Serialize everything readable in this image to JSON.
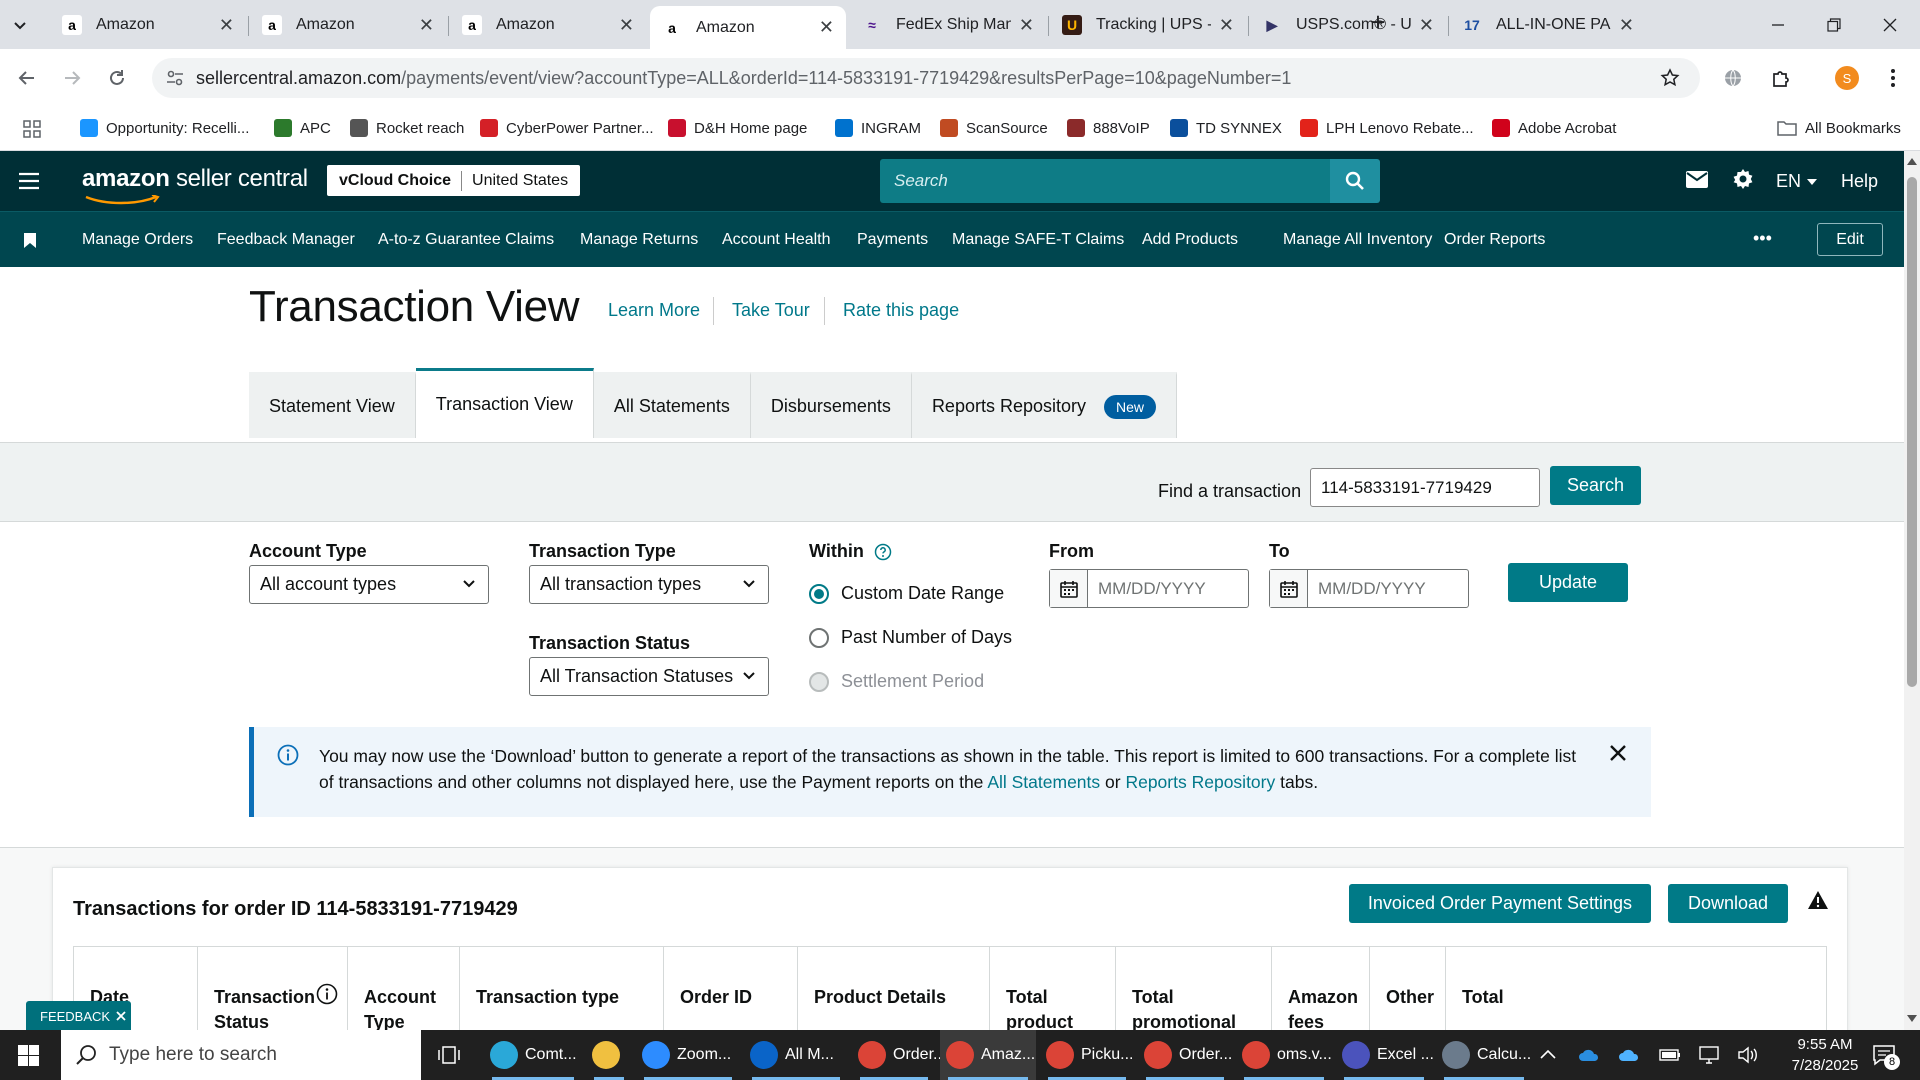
{
  "browser": {
    "tabs": [
      {
        "title": "Amazon",
        "icon": "amazon-icon"
      },
      {
        "title": "Amazon",
        "icon": "amazon-icon"
      },
      {
        "title": "Amazon",
        "icon": "amazon-icon"
      },
      {
        "title": "Amazon",
        "icon": "amazon-icon",
        "active": true
      },
      {
        "title": "FedEx Ship Mana",
        "icon": "fedex-icon"
      },
      {
        "title": "Tracking | UPS - U",
        "icon": "ups-icon"
      },
      {
        "title": "USPS.com® - US",
        "icon": "usps-icon"
      },
      {
        "title": "ALL-IN-ONE PAC",
        "icon": "seventeen-track-icon"
      }
    ],
    "url_host": "sellercentral.amazon.com",
    "url_path": "/payments/event/view?accountType=ALL&orderId=114-5833191-7719429&resultsPerPage=10&pageNumber=1",
    "profile_initial": "S",
    "bookmarks": [
      {
        "label": "Opportunity: Recelli...",
        "color": "#1b96ff"
      },
      {
        "label": "APC",
        "color": "#2c7a2c"
      },
      {
        "label": "Rocket reach",
        "color": "#555"
      },
      {
        "label": "CyberPower Partner...",
        "color": "#d42027"
      },
      {
        "label": "D&H Home page",
        "color": "#c8102e"
      },
      {
        "label": "INGRAM",
        "color": "#0072ce"
      },
      {
        "label": "ScanSource",
        "color": "#c04b22"
      },
      {
        "label": "888VoIP",
        "color": "#8b2a2a"
      },
      {
        "label": "TD SYNNEX",
        "color": "#0b4f9c"
      },
      {
        "label": "LPH Lenovo Rebate...",
        "color": "#e2231a"
      },
      {
        "label": "Adobe Acrobat",
        "color": "#d0021b"
      }
    ],
    "all_bookmarks": "All Bookmarks"
  },
  "header": {
    "logo_brand": "amazon",
    "logo_product": "seller central",
    "store_name": "vCloud Choice",
    "marketplace": "United States",
    "search_placeholder": "Search",
    "language": "EN",
    "help": "Help"
  },
  "nav": {
    "items": [
      "Manage Orders",
      "Feedback Manager",
      "A-to-z Guarantee Claims",
      "Manage Returns",
      "Account Health",
      "Payments",
      "Manage SAFE-T Claims",
      "Add Products",
      "Manage All Inventory",
      "Order Reports"
    ],
    "more": "•••",
    "edit": "Edit"
  },
  "page": {
    "title": "Transaction View",
    "links": [
      "Learn More",
      "Take Tour",
      "Rate this page"
    ],
    "tabs": [
      {
        "label": "Statement View"
      },
      {
        "label": "Transaction View",
        "active": true
      },
      {
        "label": "All Statements"
      },
      {
        "label": "Disbursements"
      },
      {
        "label": "Reports Repository",
        "badge": "New"
      }
    ]
  },
  "find": {
    "label": "Find a transaction",
    "value": "114-5833191-7719429",
    "button": "Search"
  },
  "filters": {
    "account_type_label": "Account Type",
    "account_type_value": "All account types",
    "transaction_type_label": "Transaction Type",
    "transaction_type_value": "All transaction types",
    "transaction_status_label": "Transaction Status",
    "transaction_status_value": "All Transaction Statuses",
    "within_label": "Within",
    "within_options": [
      "Custom Date Range",
      "Past Number of Days",
      "Settlement Period"
    ],
    "from_label": "From",
    "to_label": "To",
    "date_placeholder": "MM/DD/YYYY",
    "update_button": "Update"
  },
  "info": {
    "text_before": "You may now use the ‘Download’ button to generate a report of the transactions as shown in the table. This report is limited to 600 transactions. For a complete list of transactions and other columns not displayed here, use the Payment reports on the ",
    "link1": "All Statements",
    "text_mid": " or ",
    "link2": "Reports Repository",
    "text_after": " tabs."
  },
  "transactions": {
    "title": "Transactions for order ID 114-5833191-7719429",
    "settings_button": "Invoiced Order Payment Settings",
    "download_button": "Download",
    "columns": [
      "Date",
      "Transaction Status",
      "Account Type",
      "Transaction type",
      "Order ID",
      "Product Details",
      "Total product charges",
      "Total promotional rebates",
      "Amazon fees",
      "Other",
      "Total"
    ]
  },
  "feedback": "FEEDBACK",
  "taskbar": {
    "search_placeholder": "Type here to search",
    "apps": [
      {
        "label": "Comt...",
        "color": "#2aa8d8"
      },
      {
        "label": "",
        "color": "#f0c040"
      },
      {
        "label": "Zoom...",
        "color": "#2d8cff"
      },
      {
        "label": "All M...",
        "color": "#0a64c8"
      },
      {
        "label": "Order...",
        "color": "#db4437"
      },
      {
        "label": "Amaz...",
        "color": "#db4437"
      },
      {
        "label": "Picku...",
        "color": "#db4437"
      },
      {
        "label": "Order...",
        "color": "#db4437"
      },
      {
        "label": "oms.v...",
        "color": "#db4437"
      },
      {
        "label": "Excel ...",
        "color": "#4b53bc"
      },
      {
        "label": "Calcu...",
        "color": "#6b7b8c"
      }
    ],
    "time": "9:55 AM",
    "date": "7/28/2025",
    "notifications": "8"
  }
}
